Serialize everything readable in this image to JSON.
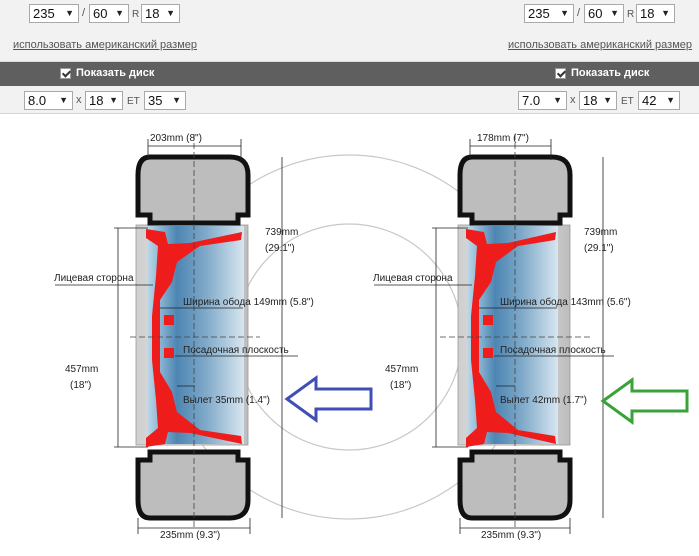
{
  "left": {
    "tire": {
      "width": "235",
      "profile": "60",
      "r_label": "R",
      "rim": "18",
      "slash": "/"
    },
    "american_link": "использовать американский размер",
    "show_disk": "Показать диск",
    "disk": {
      "width": "8.0",
      "x_label": "x",
      "diameter": "18",
      "et_label": "ET",
      "et": "35"
    },
    "dims": {
      "rim_width_top": "203mm (8\")",
      "outer_diam_1": "739mm",
      "outer_diam_2": "(29.1\")",
      "face_side": "Лицевая сторона",
      "rim_width": "Ширина обода 149mm (5.8\")",
      "mount_plane": "Посадочная плоскость",
      "rim_diam_1": "457mm",
      "rim_diam_2": "(18\")",
      "offset": "Вылет 35mm (1.4\")",
      "tire_width_bottom": "235mm (9.3\")"
    },
    "arrow_color": "#3f4fb6"
  },
  "right": {
    "tire": {
      "width": "235",
      "profile": "60",
      "r_label": "R",
      "rim": "18",
      "slash": "/"
    },
    "american_link": "использовать американский размер",
    "show_disk": "Показать диск",
    "disk": {
      "width": "7.0",
      "x_label": "x",
      "diameter": "18",
      "et_label": "ET",
      "et": "42"
    },
    "dims": {
      "rim_width_top": "178mm (7\")",
      "outer_diam_1": "739mm",
      "outer_diam_2": "(29.1\")",
      "face_side": "Лицевая сторона",
      "rim_width": "Ширина обода 143mm (5.6\")",
      "mount_plane": "Посадочная плоскость",
      "rim_diam_1": "457mm",
      "rim_diam_2": "(18\")",
      "offset": "Вылет 42mm (1.7\")",
      "tire_width_bottom": "235mm (9.3\")"
    },
    "arrow_color": "#3aa23a"
  }
}
